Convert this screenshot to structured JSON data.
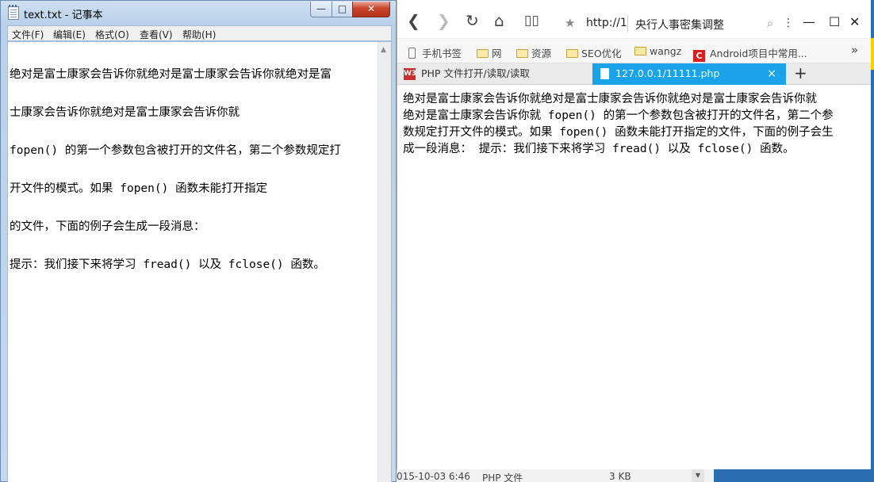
{
  "notepad": {
    "title": "text.txt - 记事本",
    "menu": [
      "文件(F)",
      "编辑(E)",
      "格式(O)",
      "查看(V)",
      "帮助(H)"
    ],
    "lines": [
      "绝对是富士康家会告诉你就绝对是富士康家会告诉你就绝对是富",
      "士康家会告诉你就绝对是富士康家会告诉你就",
      "fopen() 的第一个参数包含被打开的文件名，第二个参数规定打",
      "开文件的模式。如果 fopen() 函数未能打开指定",
      "的文件，下面的例子会生成一段消息：",
      "提示：我们接下来将学习 fread() 以及 fclose() 函数。"
    ]
  },
  "browser": {
    "url": "http://1",
    "search": "央行人事密集调整",
    "bookmarks": [
      "手机书签",
      "网",
      "资源",
      "SEO优化",
      "wangz",
      "Android项目中常用..."
    ],
    "bookmarks_more": "»",
    "tabs": [
      {
        "label": "PHP 文件打开/读取/读取",
        "icon": "W3"
      },
      {
        "label": "127.0.0.1/11111.php",
        "close": "×"
      }
    ],
    "new_tab": "+",
    "content_lines": [
      "绝对是富士康家会告诉你就绝对是富士康家会告诉你就绝对是富士康家会告诉你就",
      "绝对是富士康家会告诉你就 fopen() 的第一个参数包含被打开的文件名，第二个参",
      "数规定打开文件的模式。如果 fopen() 函数未能打开指定的文件，下面的例子会生",
      "成一段消息： 提示：我们接下来将学习 fread() 以及 fclose() 函数。"
    ]
  },
  "explorer_row": {
    "date": "015-10-03 6:46",
    "type": "PHP 文件",
    "size": "3 KB"
  }
}
